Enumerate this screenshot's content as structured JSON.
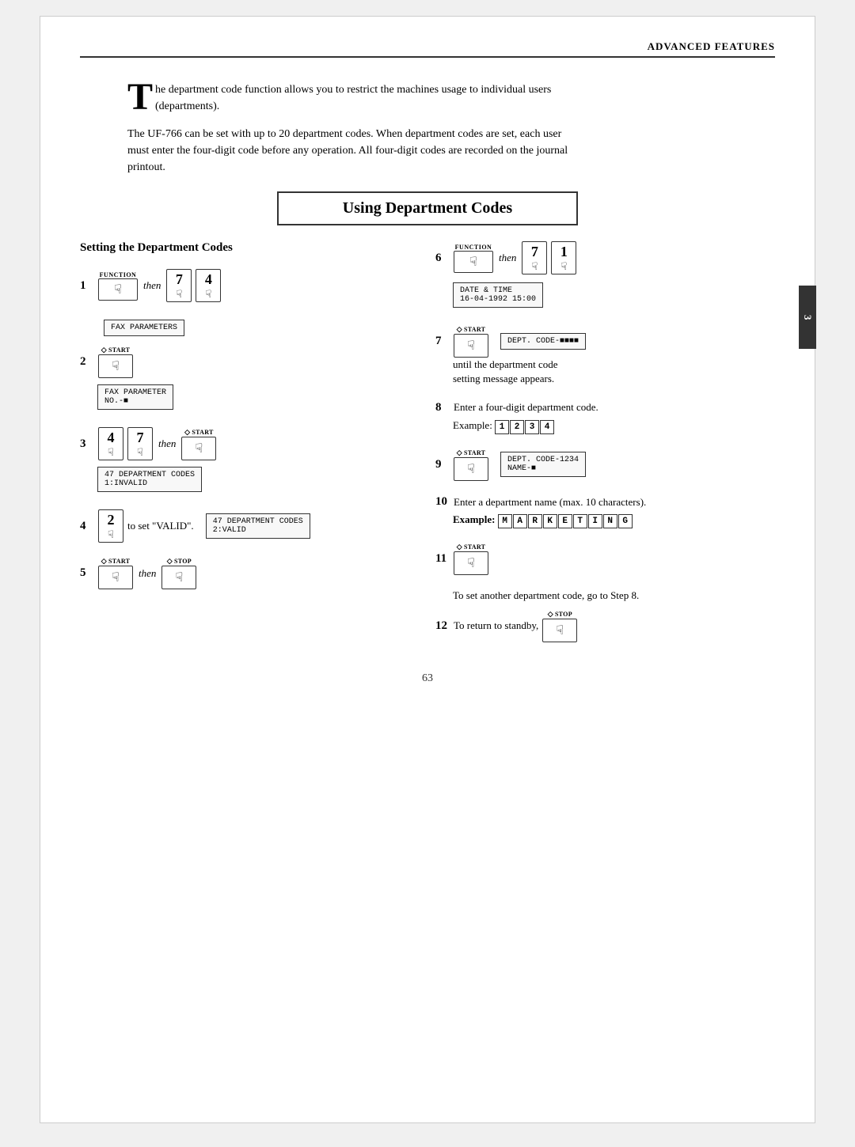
{
  "header": {
    "title": "ADVANCED FEATURES"
  },
  "side_tab": "3",
  "intro": {
    "drop_cap": "T",
    "line1": "he department code function allows you to",
    "line2": "restrict the machines usage to individual",
    "line3": "users (departments).",
    "para2_line1": "The UF-766 can be set with up to 20 department",
    "para2_line2": "codes. When department codes are set, each user",
    "para2_line3": "must enter the four-digit code before any",
    "para2_line4": "operation. All four-digit codes are recorded on the",
    "para2_line5": "journal printout."
  },
  "section_title": "Using Department Codes",
  "left_col": {
    "title": "Setting the Department Codes",
    "steps": [
      {
        "num": "1",
        "keys": [
          "FUNCTION",
          "7",
          "4"
        ],
        "then": true
      },
      {
        "num": "2",
        "keys": [
          "START"
        ],
        "display": "FAX PARAMETERS\nFAX PARAMETER\nNO.-■"
      },
      {
        "num": "3",
        "keys": [
          "4",
          "7",
          "START"
        ],
        "then": true,
        "display": "47 DEPARTMENT CODES\n1:INVALID"
      },
      {
        "num": "4",
        "key_num": "2",
        "text": "to set \"VALID\".",
        "display": "47 DEPARTMENT CODES\n2:VALID"
      },
      {
        "num": "5",
        "keys": [
          "START",
          "STOP"
        ],
        "then": true
      }
    ]
  },
  "right_col": {
    "steps": [
      {
        "num": "6",
        "keys": [
          "FUNCTION",
          "7",
          "1"
        ],
        "then": true,
        "display": "DATE & TIME\n16-04-1992 15:00"
      },
      {
        "num": "7",
        "keys": [
          "START"
        ],
        "display": "DEPT. CODE-■■■■",
        "note": "until the department code\nsetting message appears."
      },
      {
        "num": "8",
        "text": "Enter a four-digit department code.",
        "example": "1234",
        "example_label": "Example:"
      },
      {
        "num": "9",
        "keys": [
          "START"
        ],
        "display": "DEPT. CODE-1234\nNAME-■"
      },
      {
        "num": "10",
        "text": "Enter a department name (max. 10 characters).",
        "example_chars": "MARKETING",
        "example_label": "Example:"
      },
      {
        "num": "11",
        "keys": [
          "START"
        ]
      },
      {
        "num_text": "To set another department code, go to Step 8."
      },
      {
        "num": "12",
        "text": "To return to standby,",
        "keys": [
          "STOP"
        ]
      }
    ]
  },
  "page_number": "63"
}
